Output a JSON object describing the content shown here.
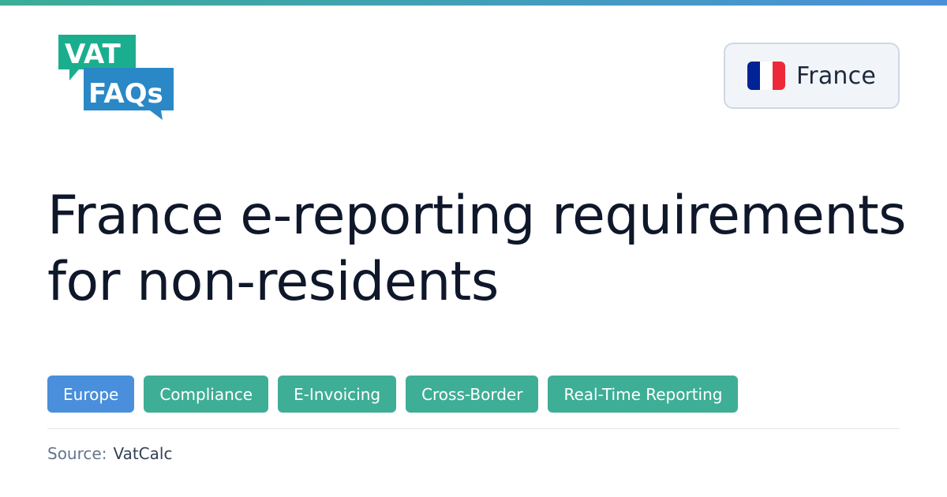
{
  "logo": {
    "line1": "VAT",
    "line2": "FAQs",
    "primary_color": "#1aae8e",
    "secondary_color": "#2a88c6"
  },
  "country": {
    "name": "France",
    "flag_icon": "france-flag-icon",
    "flag_colors": [
      "#002395",
      "#ffffff",
      "#ed2939"
    ]
  },
  "title": "France e-reporting requirements for non-residents",
  "tags": [
    {
      "label": "Europe",
      "kind": "region",
      "color": "#4a8fdb"
    },
    {
      "label": "Compliance",
      "kind": "topic",
      "color": "#3fae96"
    },
    {
      "label": "E-Invoicing",
      "kind": "topic",
      "color": "#3fae96"
    },
    {
      "label": "Cross-Border",
      "kind": "topic",
      "color": "#3fae96"
    },
    {
      "label": "Real-Time Reporting",
      "kind": "topic",
      "color": "#3fae96"
    }
  ],
  "source": {
    "label": "Source:",
    "value": "VatCalc"
  },
  "accent_gradient": [
    "#3aae96",
    "#4a90d9"
  ]
}
